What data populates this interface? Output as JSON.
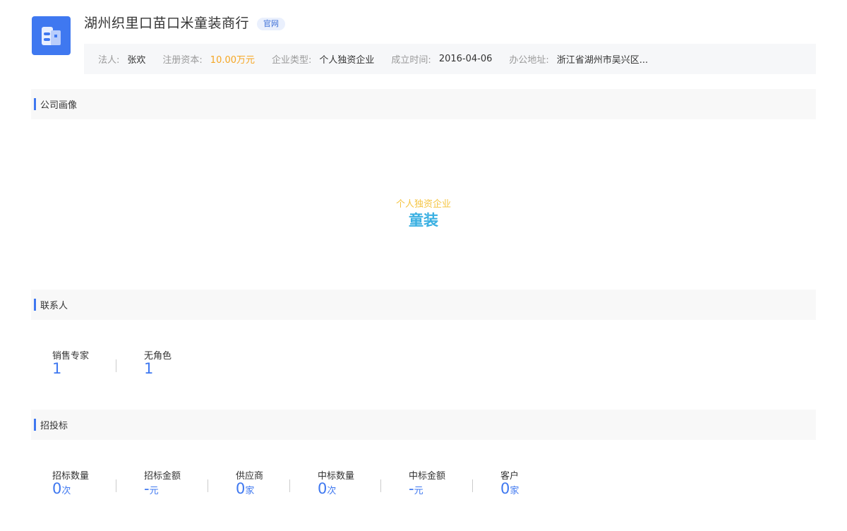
{
  "header": {
    "company_name": "湖州织里口苗口米童装商行",
    "official_site_badge": "官网",
    "info": [
      {
        "key": "法人:",
        "value": "张欢"
      },
      {
        "key": "注册资本:",
        "value": "10.00万元"
      },
      {
        "key": "企业类型:",
        "value": "个人独资企业"
      },
      {
        "key": "成立时间:",
        "value": "2016-04-06"
      },
      {
        "key": "办公地址:",
        "value": "浙江省湖州市吴兴区..."
      }
    ]
  },
  "portrait": {
    "title": "公司画像",
    "company_type": "个人独资企业",
    "business_tag": "童装"
  },
  "contacts": {
    "title": "联系人",
    "stats": [
      {
        "label": "销售专家",
        "value": "1",
        "unit": ""
      },
      {
        "label": "无角色",
        "value": "1",
        "unit": ""
      }
    ]
  },
  "bidding": {
    "title": "招投标",
    "stats": [
      {
        "label": "招标数量",
        "value": "0",
        "unit": "次"
      },
      {
        "label": "招标金额",
        "value": "-",
        "unit": "元"
      },
      {
        "label": "供应商",
        "value": "0",
        "unit": "家"
      },
      {
        "label": "中标数量",
        "value": "0",
        "unit": "次"
      },
      {
        "label": "中标金额",
        "value": "-",
        "unit": "元"
      },
      {
        "label": "客户",
        "value": "0",
        "unit": "家"
      }
    ]
  },
  "colors": {
    "accent": "#3f78f0",
    "money": "#f5a623",
    "company_type": "#f5c542",
    "business_tag": "#3ab0e2"
  },
  "icons": {
    "logo": "building-icon"
  }
}
